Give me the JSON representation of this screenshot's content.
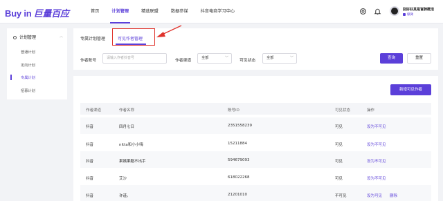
{
  "app": {
    "logo_en": "Buy in",
    "logo_cn": "巨量百应"
  },
  "nav": {
    "items": [
      "首页",
      "计划管理",
      "精选联盟",
      "数据参谋",
      "抖音电商学习中心"
    ],
    "active_index": 1
  },
  "header": {
    "user_name": "别好好其是官肺概活",
    "user_tag": "级微"
  },
  "sidebar": {
    "group": "计划管理",
    "items": [
      "普通计划",
      "定向计划",
      "专属计划",
      "招募计划"
    ],
    "active_index": 2
  },
  "tabs": {
    "items": [
      "专属计划管理",
      "可见作者管理"
    ],
    "active_index": 1
  },
  "filters": {
    "author_label": "作者账号",
    "author_placeholder": "请输入作者抖音号",
    "channel_label": "作者渠道",
    "channel_value": "全部",
    "status_label": "可见状态",
    "status_value": "全部",
    "query_button": "查询",
    "reset_button": "重置"
  },
  "table": {
    "add_button": "新增可见作者",
    "columns": [
      "作者渠道",
      "作者名称",
      "账号ID",
      "可见状态",
      "操作"
    ],
    "rows": [
      {
        "channel": "抖音",
        "name": "四月七日",
        "id": "2351558239",
        "status": "可见",
        "action": "设为不可见",
        "extra": ""
      },
      {
        "channel": "抖音",
        "name": "nitta和小小嗨",
        "id": "15211884",
        "status": "可见",
        "action": "设为不可见",
        "extra": ""
      },
      {
        "channel": "抖音",
        "name": "果姨果酷不出手",
        "id": "594679093",
        "status": "可见",
        "action": "设为不可见",
        "extra": ""
      },
      {
        "channel": "抖音",
        "name": "艾沙",
        "id": "618022268",
        "status": "可见",
        "action": "设为不可见",
        "extra": ""
      },
      {
        "channel": "抖音",
        "name": "许谨。",
        "id": "21201010",
        "status": "不可见",
        "action": "设为可见",
        "extra": "删除"
      }
    ]
  },
  "colors": {
    "accent": "#5b3fd9",
    "annotation": "#e0332c"
  }
}
